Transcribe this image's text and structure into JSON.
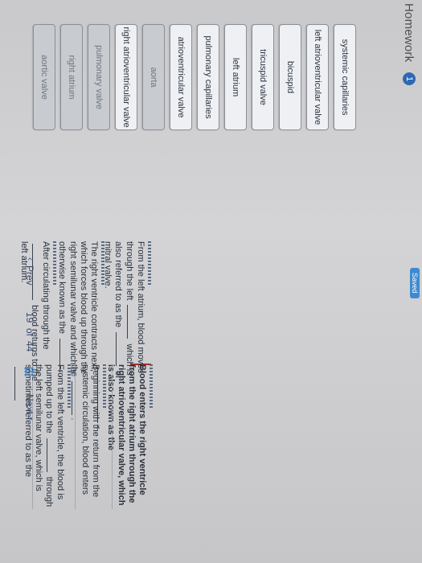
{
  "header": {
    "title": "Homework",
    "badge": "1",
    "status": "Saved"
  },
  "tiles": [
    {
      "label": "systemic capillaries",
      "faded": false
    },
    {
      "label": "left atrioventricular valve",
      "faded": false
    },
    {
      "label": "bicuspid",
      "faded": false
    },
    {
      "label": "tricuspid valve",
      "faded": false
    },
    {
      "label": "left atrium",
      "faded": false
    },
    {
      "label": "pulmonary capillaries",
      "faded": false
    },
    {
      "label": "atrioventricular valve",
      "faded": false
    },
    {
      "label": "aorta",
      "faded": true
    },
    {
      "label": "right atrioventricular valve",
      "faded": false
    },
    {
      "label": "pulmonary valve",
      "faded": true
    },
    {
      "label": "right atrium",
      "faded": true
    },
    {
      "label": "aortic valve",
      "faded": true
    }
  ],
  "questions": [
    {
      "text_a": "Blood enters the right ventricle from the right atrium through the right atrioventricular valve, which is also known as the",
      "text_b": "."
    },
    {
      "text_a": "Beginning with the return from the systemic circulation, blood enters the",
      "text_b": "."
    },
    {
      "text_a": "From the left ventricle, the blood is pumped up to the",
      "text_b": "through the left semilunar valve, which is sometimes referred to as the"
    },
    {
      "text_a": "From the left atrium, blood moves through the left",
      "text_b": "which is also referred to as the",
      "text_c": "or mitral valve."
    },
    {
      "text_a": "The right ventricle contracts next, which forces blood up through the right semilunar valve and which is otherwise known as the",
      "text_b": "."
    },
    {
      "text_a": "After circulating through the",
      "text_b": "blood returns to the left atrium."
    }
  ],
  "nav": {
    "prev": "Prev",
    "page_current": "19",
    "page_of": "of",
    "page_total": "44",
    "next": "Next"
  }
}
